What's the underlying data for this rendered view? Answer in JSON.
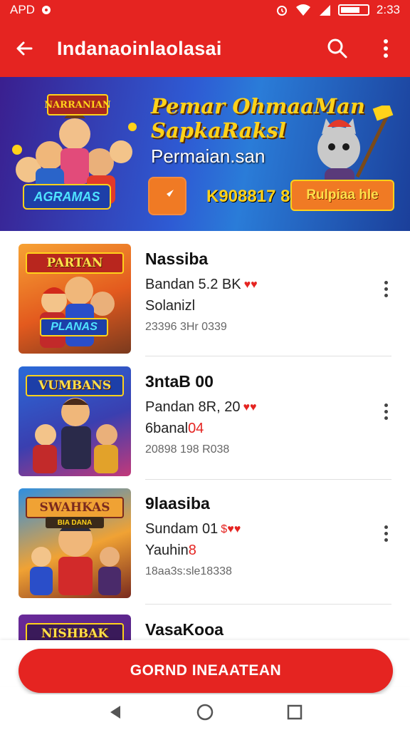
{
  "status_bar": {
    "carrier": "APD",
    "time": "2:33"
  },
  "app_bar": {
    "title": "Indanaoinlaolasai",
    "back_icon": "arrow-left-icon",
    "search_icon": "search-icon",
    "more_icon": "more-vertical-icon"
  },
  "banner": {
    "art_logo": "NARRANIAN",
    "art_sub_logo": "AGRAMAS",
    "title_line1": "Pemar OhmaaMan",
    "title_line2": "SapkaRaksl",
    "subtitle": "Permaian.san",
    "code": "K908817 8",
    "cta_label": "Rulpiaa hle",
    "play_icon": "play-arrow-icon"
  },
  "items": [
    {
      "thumb_label": "PARTAN",
      "thumb_sub": "PLANAS",
      "name": "Nassiba",
      "meta": "Bandan 5.2 BK",
      "hearts": "♥♥",
      "sub": "Solanizl",
      "stat": "23396 3Hr 0339"
    },
    {
      "thumb_label": "VUMBANS",
      "thumb_sub": "",
      "name": "3ntaB 00",
      "meta": "Pandan 8R, 20",
      "hearts": "♥♥",
      "sub": "6banal",
      "sub_badge": "04",
      "stat": "20898 198 R038"
    },
    {
      "thumb_label": "SWAHKAS",
      "thumb_sub": "BIA DANA",
      "name": "9laasiba",
      "meta": "Sundam 01",
      "hearts": "$♥♥",
      "sub": "Yauhin",
      "sub_badge": "8",
      "stat": "18aa3s:sle18338"
    },
    {
      "thumb_label": "NISHBAK",
      "thumb_sub": "",
      "name": "VasaKooa"
    }
  ],
  "cta": {
    "label": "GORND INEAATEAN"
  },
  "nav": {
    "back_icon": "nav-back-icon",
    "home_icon": "nav-home-icon",
    "recents_icon": "nav-recents-icon"
  },
  "colors": {
    "primary": "#e52421",
    "accent": "#f07a24",
    "gold": "#ffd21a"
  }
}
